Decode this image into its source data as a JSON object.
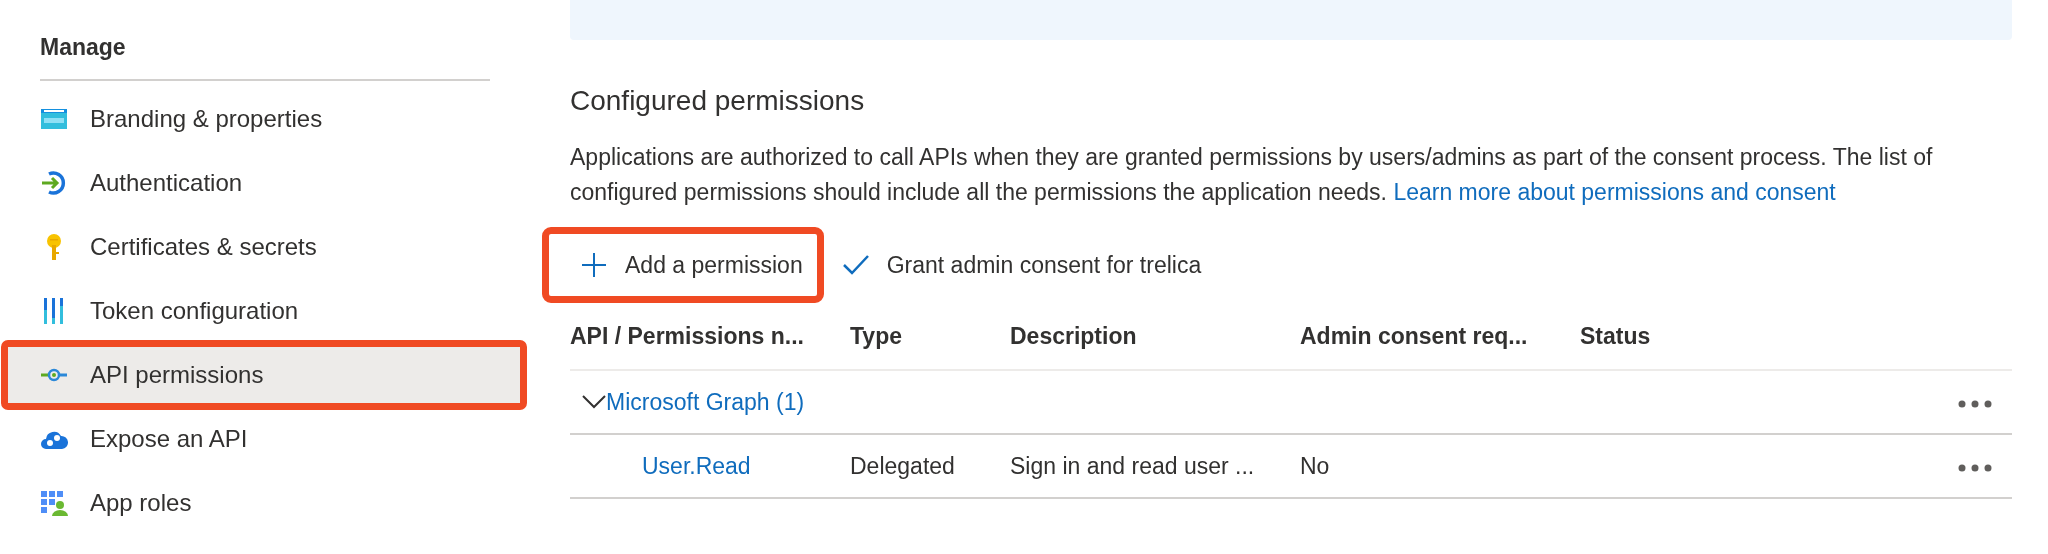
{
  "sidebar": {
    "section_title": "Manage",
    "items": [
      {
        "label": "Branding & properties",
        "kind": "www",
        "selected": false,
        "highlighted": false
      },
      {
        "label": "Authentication",
        "kind": "auth",
        "selected": false,
        "highlighted": false
      },
      {
        "label": "Certificates & secrets",
        "kind": "key",
        "selected": false,
        "highlighted": false
      },
      {
        "label": "Token configuration",
        "kind": "token",
        "selected": false,
        "highlighted": false
      },
      {
        "label": "API permissions",
        "kind": "api",
        "selected": true,
        "highlighted": true
      },
      {
        "label": "Expose an API",
        "kind": "cloud",
        "selected": false,
        "highlighted": false
      },
      {
        "label": "App roles",
        "kind": "roles",
        "selected": false,
        "highlighted": false
      }
    ]
  },
  "main": {
    "heading": "Configured permissions",
    "description": "Applications are authorized to call APIs when they are granted permissions by users/admins as part of the consent process. The list of configured permissions should include all the permissions the application needs.",
    "learn_more_link": "Learn more about permissions and consent",
    "toolbar": [
      {
        "label": "Add a permission",
        "kind": "add",
        "highlighted": true
      },
      {
        "label": "Grant admin consent for trelica",
        "kind": "grant",
        "highlighted": false
      }
    ],
    "table": {
      "columns": [
        "API / Permissions n...",
        "Type",
        "Description",
        "Admin consent req...",
        "Status"
      ],
      "groups": [
        {
          "name": "Microsoft Graph (1)",
          "expanded": true,
          "rows": [
            {
              "name": "User.Read",
              "type": "Delegated",
              "description": "Sign in and read user ...",
              "admin_consent": "No"
            }
          ]
        }
      ]
    }
  }
}
